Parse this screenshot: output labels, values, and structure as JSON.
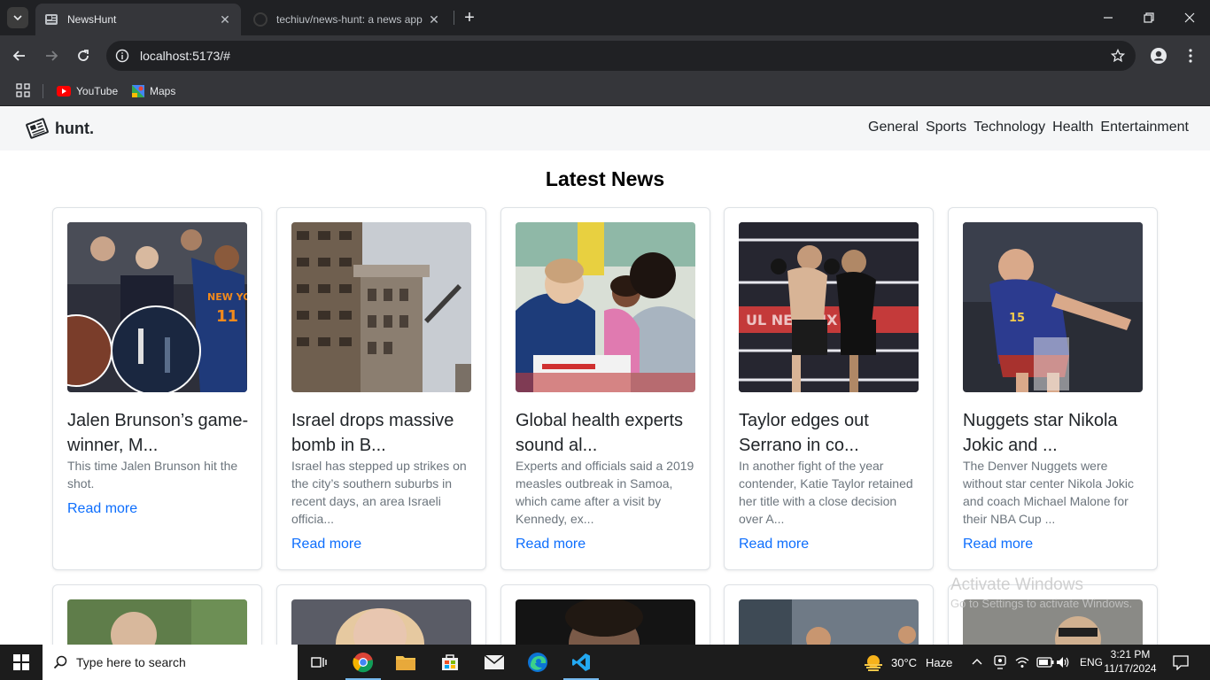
{
  "browser": {
    "tabs": [
      {
        "title": "NewsHunt",
        "active": true
      },
      {
        "title": "techiuv/news-hunt: a news app",
        "active": false
      }
    ],
    "url": "localhost:5173/#",
    "bookmarks": [
      {
        "label": "YouTube"
      },
      {
        "label": "Maps"
      }
    ]
  },
  "site": {
    "brand": "hunt.",
    "nav": [
      "General",
      "Sports",
      "Technology",
      "Health",
      "Entertainment"
    ],
    "heading": "Latest News",
    "read_more": "Read more",
    "articles": [
      {
        "title": "Jalen Brunson’s game-winner, M...",
        "desc": "This time Jalen Brunson hit the shot."
      },
      {
        "title": "Israel drops massive bomb in B...",
        "desc": "Israel has stepped up strikes on the city’s southern suburbs in recent days, an area Israeli officia..."
      },
      {
        "title": "Global health experts sound al...",
        "desc": "Experts and officials said a 2019 measles outbreak in Samoa, which came after a visit by Kennedy, ex..."
      },
      {
        "title": "Taylor edges out Serrano in co...",
        "desc": "In another fight of the year contender, Katie Taylor retained her title with a close decision over A..."
      },
      {
        "title": "Nuggets star Nikola Jokic and ...",
        "desc": "The Denver Nuggets were without star center Nikola Jokic and coach Michael Malone for their NBA Cup ..."
      }
    ]
  },
  "watermark": {
    "line1": "Activate Windows",
    "line2": "Go to Settings to activate Windows."
  },
  "taskbar": {
    "search_placeholder": "Type here to search",
    "weather_temp": "30°C",
    "weather_desc": "Haze",
    "lang": "ENG",
    "time": "3:21 PM",
    "date": "11/17/2024"
  },
  "colors": {
    "link": "#0d6efd",
    "navbar_bg": "#f5f6f7",
    "chrome_dark": "#202124",
    "chrome_mid": "#35363a"
  }
}
